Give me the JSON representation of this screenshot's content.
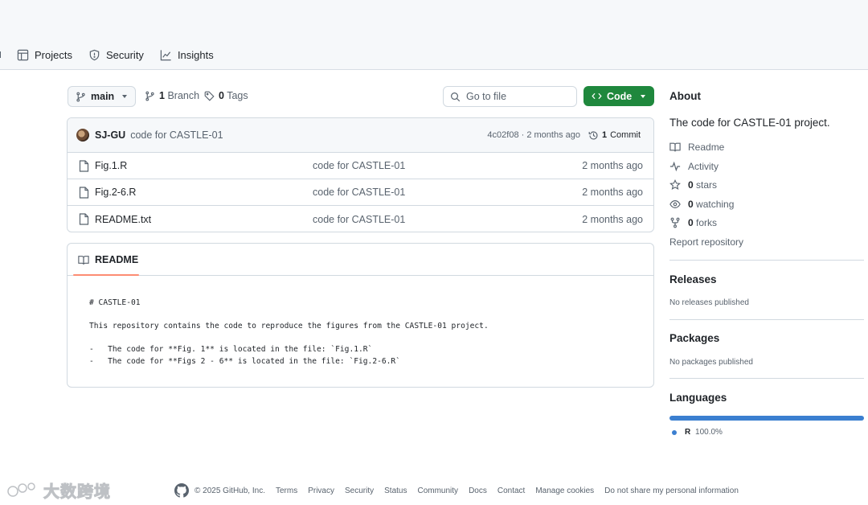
{
  "nav": {
    "items": [
      {
        "label": "Projects",
        "icon": "table-icon"
      },
      {
        "label": "Security",
        "icon": "shield-icon"
      },
      {
        "label": "Insights",
        "icon": "graph-icon"
      }
    ]
  },
  "repo": {
    "branch": "main",
    "branch_count": "1",
    "branch_label": "Branch",
    "tag_count": "0",
    "tag_label": "Tags",
    "goto_placeholder": "Go to file",
    "code_button": "Code"
  },
  "commit": {
    "author": "SJ-GU",
    "message": "code for CASTLE-01",
    "hash_time": "4c02f08 · 2 months ago",
    "count": "1",
    "count_label": "Commit"
  },
  "files": [
    {
      "name": "Fig.1.R",
      "message": "code for CASTLE-01",
      "date": "2 months ago"
    },
    {
      "name": "Fig.2-6.R",
      "message": "code for CASTLE-01",
      "date": "2 months ago"
    },
    {
      "name": "README.txt",
      "message": "code for CASTLE-01",
      "date": "2 months ago"
    }
  ],
  "readme": {
    "tab": "README",
    "lines": [
      "# CASTLE-01",
      "",
      "This repository contains the code to reproduce the figures from the CASTLE-01 project.",
      "",
      "-   The code for **Fig. 1** is located in the file: `Fig.1.R`",
      "-   The code for **Figs 2 - 6** is located in the file: `Fig.2-6.R`"
    ]
  },
  "about": {
    "heading": "About",
    "description": "The code for CASTLE-01 project.",
    "readme_link": "Readme",
    "activity_link": "Activity",
    "stars_count": "0",
    "stars_label": "stars",
    "watching_count": "0",
    "watching_label": "watching",
    "forks_count": "0",
    "forks_label": "forks",
    "report": "Report repository"
  },
  "releases": {
    "heading": "Releases",
    "text": "No releases published"
  },
  "packages": {
    "heading": "Packages",
    "text": "No packages published"
  },
  "languages": {
    "heading": "Languages",
    "name": "R",
    "percent": "100.0%",
    "color": "#3b7fd0"
  },
  "footer": {
    "copyright": "© 2025 GitHub, Inc.",
    "links": [
      "Terms",
      "Privacy",
      "Security",
      "Status",
      "Community",
      "Docs",
      "Contact",
      "Manage cookies",
      "Do not share my personal information"
    ]
  },
  "watermark": {
    "text": "大数跨境"
  },
  "colors": {
    "accent_green": "#1f883d",
    "tab_underline": "#fd8c73",
    "lang_r": "#3b7fd0"
  }
}
